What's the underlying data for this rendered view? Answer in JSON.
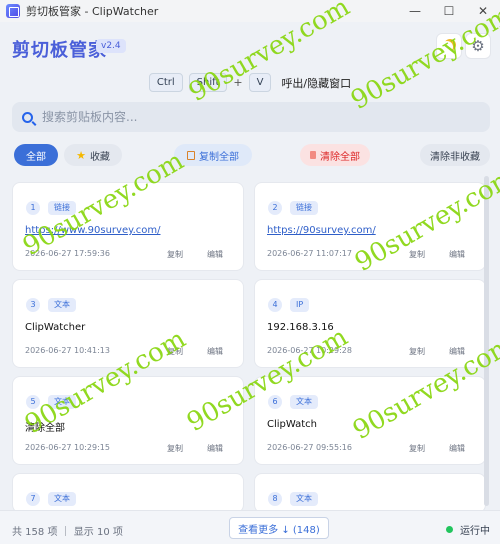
{
  "window": {
    "title": "剪切板管家 - ClipWatcher",
    "minimize": "—",
    "maximize": "☐",
    "close": "✕"
  },
  "header": {
    "title": "剪切板管家",
    "version": "v2.4",
    "theme_icon": "moon-icon",
    "settings_icon": "gear-icon",
    "settings_glyph": "⚙"
  },
  "shortcut": {
    "keys": [
      "Ctrl",
      "Shift",
      "V"
    ],
    "plus": "+",
    "label": "呼出/隐藏窗口"
  },
  "search": {
    "placeholder": "搜索剪贴板内容..."
  },
  "filters": {
    "all": "全部",
    "favorites": "收藏",
    "copy_all": "复制全部",
    "clear_all": "清除全部",
    "clear_non_fav": "清除非收藏"
  },
  "colors": {
    "accent": "#3b6fd8",
    "danger": "#dc2626",
    "status_ok": "#22c55e",
    "watermark": "#88d60e"
  },
  "cards": [
    {
      "num": "1",
      "tag": "链接",
      "content": "https://www.90survey.com/",
      "time": "2026-06-27 17:59:36",
      "copy": "复制",
      "edit": "编辑",
      "is_link": true
    },
    {
      "num": "2",
      "tag": "链接",
      "content": "https://90survey.com/",
      "time": "2026-06-27 11:07:17",
      "copy": "复制",
      "edit": "编辑",
      "is_link": true
    },
    {
      "num": "3",
      "tag": "文本",
      "content": "ClipWatcher",
      "time": "2026-06-27 10:41:13",
      "copy": "复制",
      "edit": "编辑",
      "is_link": false
    },
    {
      "num": "4",
      "tag": "IP",
      "content": "192.168.3.16",
      "time": "2026-06-27 10:29:28",
      "copy": "复制",
      "edit": "编辑",
      "is_link": false
    },
    {
      "num": "5",
      "tag": "文本",
      "content": "清除全部",
      "time": "2026-06-27 10:29:15",
      "copy": "复制",
      "edit": "编辑",
      "is_link": false
    },
    {
      "num": "6",
      "tag": "文本",
      "content": "ClipWatch",
      "time": "2026-06-27 09:55:16",
      "copy": "复制",
      "edit": "编辑",
      "is_link": false
    },
    {
      "num": "7",
      "tag": "文本",
      "content": "",
      "time": "",
      "copy": "",
      "edit": "",
      "is_link": false
    },
    {
      "num": "8",
      "tag": "文本",
      "content": "",
      "time": "",
      "copy": "",
      "edit": "",
      "is_link": false
    }
  ],
  "footer": {
    "stats": "共 158 项 ｜ 显示 10 项",
    "load_more": "查看更多 ↓ (148)",
    "status": "运行中"
  },
  "watermark": {
    "text": "90survey.com"
  }
}
